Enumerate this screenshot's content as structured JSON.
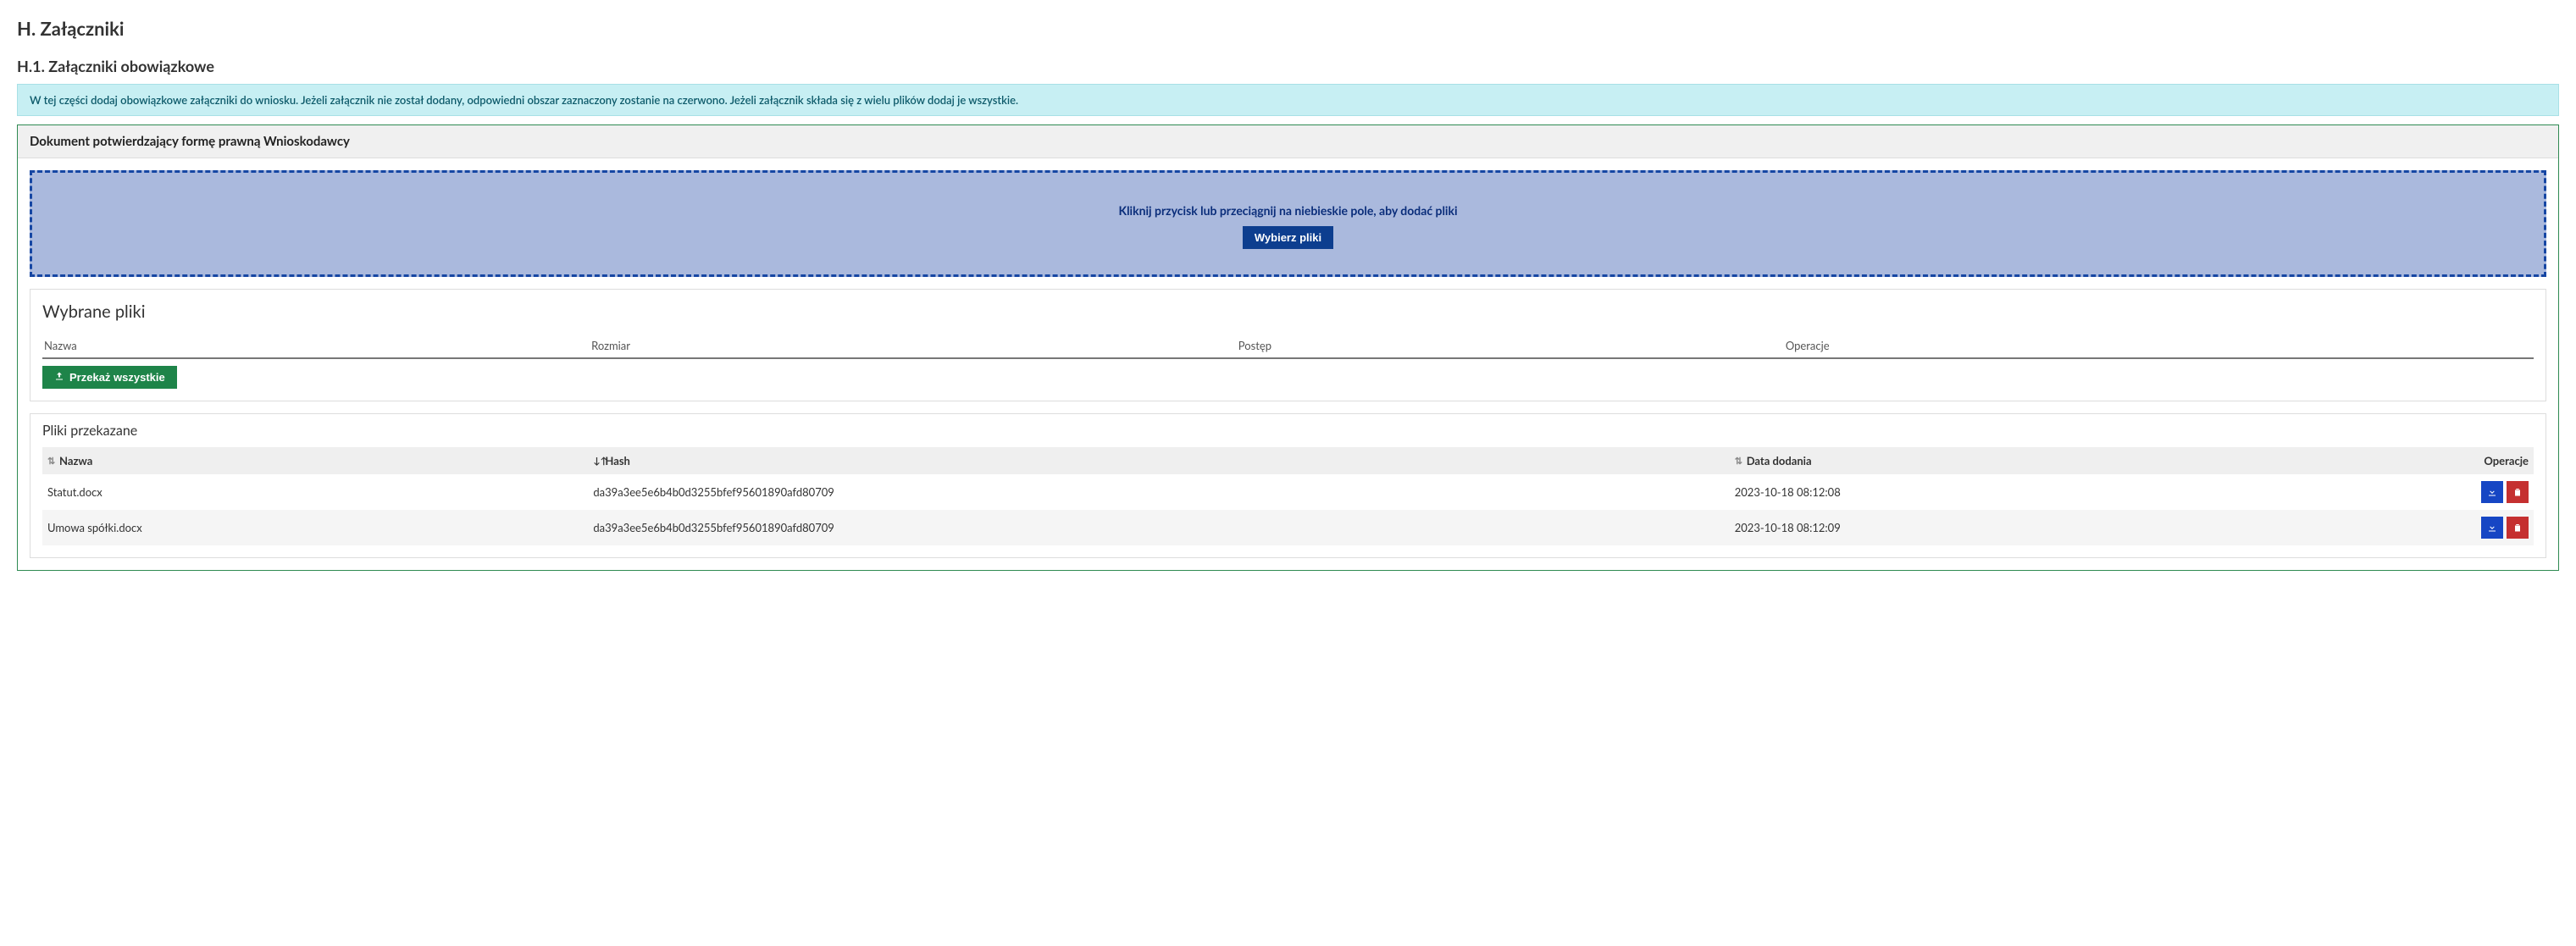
{
  "section": {
    "title": "H. Załączniki",
    "subtitle": "H.1. Załączniki obowiązkowe",
    "info": "W tej części dodaj obowiązkowe załączniki do wniosku. Jeżeli załącznik nie został dodany, odpowiedni obszar zaznaczony zostanie na czerwono. Jeżeli załącznik składa się z wielu plików dodaj je wszystkie."
  },
  "panel": {
    "title": "Dokument potwierdzający formę prawną Wnioskodawcy"
  },
  "dropzone": {
    "text": "Kliknij przycisk lub przeciągnij na niebieskie pole, aby dodać pliki",
    "button": "Wybierz pliki"
  },
  "selected": {
    "title": "Wybrane pliki",
    "headers": {
      "name": "Nazwa",
      "size": "Rozmiar",
      "progress": "Postęp",
      "ops": "Operacje"
    },
    "uploadAll": "Przekaż wszystkie"
  },
  "transferred": {
    "title": "Pliki przekazane",
    "headers": {
      "name": "Nazwa",
      "hash": "Hash",
      "date": "Data dodania",
      "ops": "Operacje"
    },
    "rows": [
      {
        "name": "Statut.docx",
        "hash": "da39a3ee5e6b4b0d3255bfef95601890afd80709",
        "date": "2023-10-18 08:12:08"
      },
      {
        "name": "Umowa spółki.docx",
        "hash": "da39a3ee5e6b4b0d3255bfef95601890afd80709",
        "date": "2023-10-18 08:12:09"
      }
    ]
  }
}
